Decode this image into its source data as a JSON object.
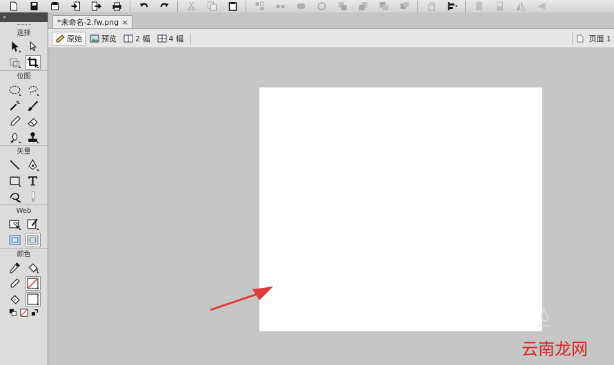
{
  "toolbar": {
    "icons": [
      "new-icon",
      "save-icon",
      "open-icon",
      "import-icon",
      "export-icon",
      "print-icon",
      "undo-icon",
      "redo-icon",
      "cut-icon",
      "copy-icon",
      "paste-icon",
      "group-icon",
      "ungroup-icon",
      "union-icon",
      "subtract-icon",
      "bring-front-icon",
      "send-back-icon",
      "align-icon",
      "distribute-icon",
      "rotate-icon",
      "align-menu-icon",
      "flip-icon",
      "flip-vertical-icon",
      "mirror-icon",
      "skew-icon"
    ]
  },
  "tools_panel": {
    "header_glyph": "»",
    "sections": {
      "select": "选择",
      "bitmap": "位图",
      "vector": "矢量",
      "web": "Web",
      "colors": "颜色"
    }
  },
  "document": {
    "tab_title": "*未命名-2.fw.png",
    "close_glyph": "×"
  },
  "view_modes": {
    "original": "原始",
    "preview": "预览",
    "two_up": "2 幅",
    "four_up": "4 幅",
    "page": "页面 1"
  },
  "colors": {
    "workspace": "#c6c6c6",
    "canvas": "#ffffff",
    "arrow": "#e0393b",
    "watermark": "#d22222"
  },
  "watermark": {
    "text": "云南龙网"
  }
}
